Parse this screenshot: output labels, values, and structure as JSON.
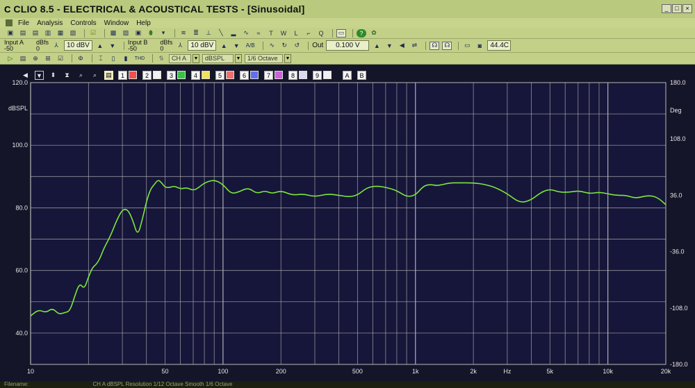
{
  "window": {
    "title": "CLIO 8.5 - ELECTRICAL & ACOUSTICAL TESTS - [Sinusoidal]",
    "app_letter": "C",
    "minimize": "_",
    "maximize": "□",
    "close": "×"
  },
  "menu": [
    "File",
    "Analysis",
    "Controls",
    "Window",
    "Help"
  ],
  "toolbar2": {
    "input_a_label": "Input A",
    "input_a_value": "-50",
    "dbfs_a_label": "dBfs",
    "dbfs_a_value": "0",
    "input_a_range": "10 dBV",
    "input_b_label": "Input B",
    "input_b_value": "-50",
    "dbfs_b_label": "dBfs",
    "dbfs_b_value": "0",
    "input_b_range": "10 dBV",
    "ab_label": "A/B",
    "out_label": "Out",
    "out_value": "0.100 V",
    "temperature": "44.4C"
  },
  "toolbar3": {
    "channel": "CH A",
    "unit": "dBSPL",
    "smoothing": "1/6 Octave",
    "thd_label": "THD"
  },
  "graph_toolbar": {
    "memory_slots": [
      "1",
      "2",
      "3",
      "4",
      "5",
      "6",
      "7",
      "8",
      "9"
    ],
    "overlay_a": "A",
    "overlay_b": "B"
  },
  "chart_data": {
    "type": "line",
    "ylabel": "dBSPL",
    "y2label": "Deg",
    "xunit": "Hz",
    "xscale": "log",
    "xlim": [
      10,
      20000
    ],
    "ylim": [
      30,
      120
    ],
    "y2lim": [
      -180,
      180
    ],
    "y_ticks": [
      "120.0",
      "100.0",
      "80.0",
      "60.0",
      "40.0"
    ],
    "y2_ticks": [
      "180.0",
      "108.0",
      "36.0",
      "-36.0",
      "-108.0",
      "-180.0"
    ],
    "x_ticks": [
      "10",
      "50",
      "100",
      "200",
      "500",
      "1k",
      "2k",
      "5k",
      "10k",
      "20k"
    ],
    "grid": true,
    "colors": {
      "background": "#16163a",
      "grid": "#b9b9b9",
      "trace": "#7de83c",
      "axis_text": "#e6e6e6"
    },
    "series": [
      {
        "name": "",
        "x": [
          10,
          11,
          12,
          13,
          14,
          15,
          16,
          17,
          18,
          19,
          20,
          21,
          22,
          23,
          24,
          26,
          28,
          30,
          32,
          34,
          36,
          38,
          40,
          42,
          44,
          46,
          48,
          50,
          53,
          56,
          60,
          65,
          70,
          75,
          80,
          90,
          100,
          110,
          120,
          135,
          150,
          165,
          180,
          200,
          230,
          260,
          300,
          350,
          400,
          450,
          500,
          560,
          630,
          710,
          800,
          900,
          1000,
          1100,
          1200,
          1300,
          1500,
          1700,
          2000,
          2300,
          2600,
          3000,
          3500,
          4000,
          4500,
          5000,
          5600,
          6300,
          7100,
          8000,
          9000,
          10000,
          11000,
          12500,
          14000,
          16000,
          18000,
          20000
        ],
        "y": [
          45.5,
          47.5,
          46.5,
          48,
          46,
          46.5,
          47,
          52,
          56,
          54,
          58,
          61,
          62,
          64,
          67,
          71,
          76,
          79.5,
          79.5,
          76,
          71,
          76,
          82,
          86,
          87.5,
          89,
          88,
          86.5,
          86.5,
          87,
          86,
          86.5,
          85.5,
          86.5,
          88,
          89,
          87.5,
          84.5,
          85,
          86.5,
          84.5,
          85.5,
          84.5,
          85.5,
          84,
          84.5,
          83.5,
          84.5,
          84,
          83.5,
          84,
          86.5,
          87,
          86.5,
          85.5,
          83.5,
          84,
          87,
          87.5,
          87,
          88,
          88,
          88,
          87.5,
          86.5,
          84.5,
          81.5,
          82.5,
          85,
          86,
          85,
          85,
          85.5,
          84.5,
          85,
          84.5,
          84,
          84,
          83,
          84,
          83.5,
          81
        ]
      }
    ]
  },
  "status": {
    "filename_label": "Filename:",
    "summary": "CH A  dBSPL  Resolution 1/12 Octave  Smooth 1/6 Octave"
  }
}
